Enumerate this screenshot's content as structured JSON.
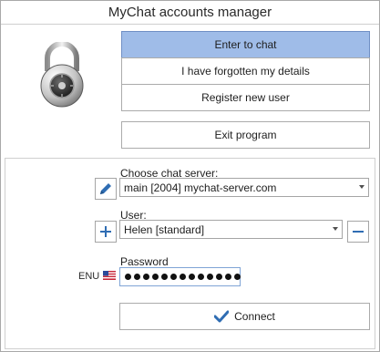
{
  "window": {
    "title": "MyChat accounts manager"
  },
  "menu": {
    "enter_label": "Enter to chat",
    "forgot_label": "I have forgotten my details",
    "register_label": "Register new user",
    "exit_label": "Exit program"
  },
  "form": {
    "server_label": "Choose chat server:",
    "server_value": "main [2004] mychat-server.com",
    "user_label": "User:",
    "user_value": "Helen [standard]",
    "password_label": "Password",
    "keyboard_layout": "ENU",
    "password_length": 13,
    "connect_label": "Connect"
  },
  "icons": {
    "lock": "padlock-icon",
    "edit_server": "pencil-icon",
    "add_user": "plus-icon",
    "remove_user": "minus-icon",
    "flag": "us-flag-icon",
    "connect": "checkmark-icon"
  },
  "colors": {
    "primary_button": "#9fbce8",
    "icon_blue": "#2f6db3"
  }
}
